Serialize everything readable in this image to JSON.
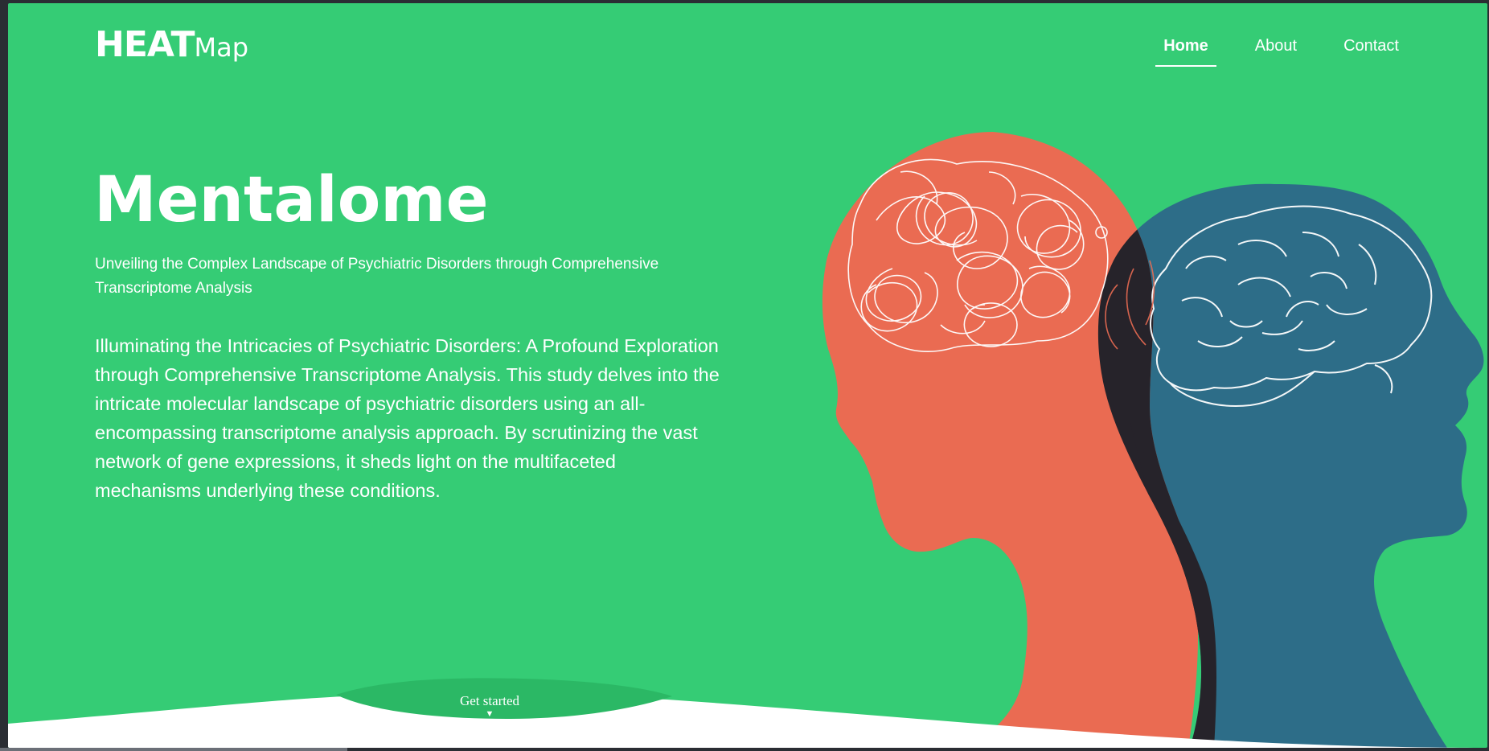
{
  "header": {
    "logo_bold": "HEAT",
    "logo_light": "Map",
    "nav": [
      {
        "label": "Home",
        "active": true
      },
      {
        "label": "About",
        "active": false
      },
      {
        "label": "Contact",
        "active": false
      }
    ]
  },
  "hero": {
    "title": "Mentalome",
    "subtitle": "Unveiling the Complex Landscape of Psychiatric Disorders through Comprehensive Transcriptome Analysis",
    "description": "Illuminating the Intricacies of Psychiatric Disorders: A Profound Exploration through Comprehensive Transcriptome Analysis. This study delves into the intricate molecular landscape of psychiatric disorders using an all-encompassing transcriptome analysis approach. By scrutinizing the vast network of gene expressions, it sheds light on the multifaceted mechanisms underlying these conditions.",
    "cta_label": "Get started",
    "cta_icon": "caret-down-icon"
  },
  "colors": {
    "background": "#35cc75",
    "head_left": "#ea6b52",
    "head_right": "#2d6d88",
    "overlap": "#26232a",
    "wave": "#ffffff"
  },
  "illustration": {
    "name": "two-heads-brain-illustration"
  }
}
